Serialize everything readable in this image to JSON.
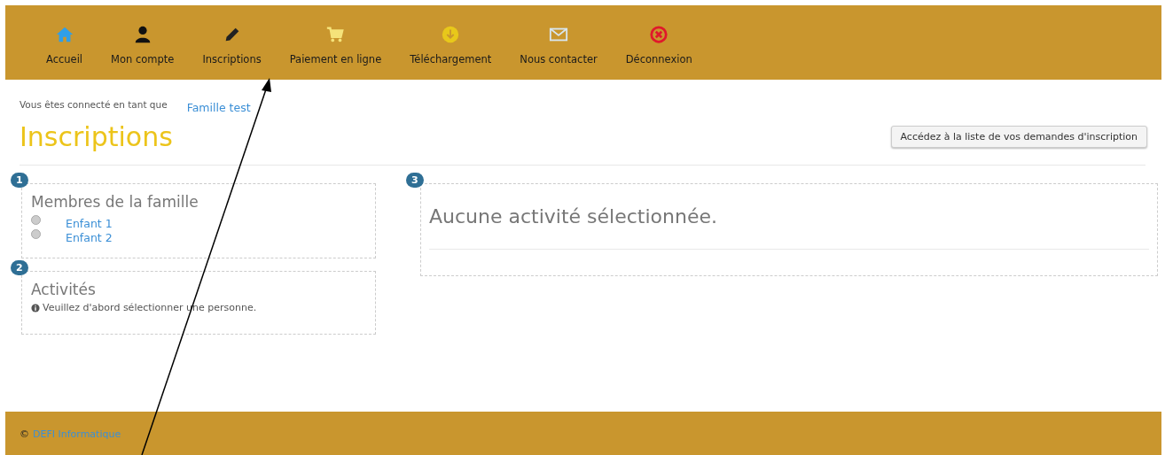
{
  "nav": [
    {
      "label": "Accueil",
      "kind": "home"
    },
    {
      "label": "Mon compte",
      "kind": "user"
    },
    {
      "label": "Inscriptions",
      "kind": "pencil"
    },
    {
      "label": "Paiement en ligne",
      "kind": "cart"
    },
    {
      "label": "Téléchargement",
      "kind": "download"
    },
    {
      "label": "Nous contacter",
      "kind": "mail"
    },
    {
      "label": "Déconnexion",
      "kind": "logout"
    }
  ],
  "login": {
    "text": "Vous êtes connecté en tant que",
    "user": "Famille test"
  },
  "title": "Inscriptions",
  "requests_button": "Accédez à la liste de vos demandes d'inscription",
  "steps": [
    {
      "number": "1",
      "title": "Membres de la famille",
      "members": [
        {
          "name": "Enfant 1",
          "selected": false
        },
        {
          "name": "Enfant 2",
          "selected": false
        }
      ]
    },
    {
      "number": "2",
      "title": "Activités",
      "info": "Veuillez d'abord sélectionner une personne."
    },
    {
      "number": "3",
      "title": "Aucune activité sélectionnée."
    }
  ],
  "footer": {
    "symbol": "©",
    "company": "DEFI Informatique"
  }
}
